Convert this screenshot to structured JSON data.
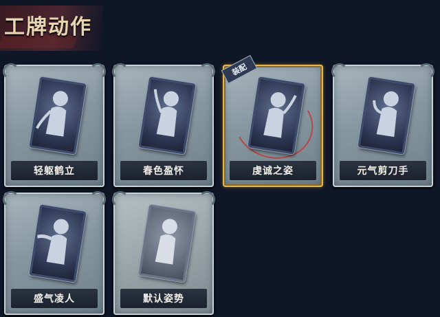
{
  "header": {
    "title": "工牌动作"
  },
  "cards": [
    {
      "label": "轻躯鹤立",
      "equipped": false,
      "disabled": false
    },
    {
      "label": "春色盈怀",
      "equipped": false,
      "disabled": false
    },
    {
      "label": "虔诚之姿",
      "equipped": true,
      "disabled": false,
      "badge": "装配"
    },
    {
      "label": "元气剪刀手",
      "equipped": false,
      "disabled": false
    },
    {
      "label": "盛气凌人",
      "equipped": false,
      "disabled": false
    },
    {
      "label": "默认姿势",
      "equipped": false,
      "disabled": true
    }
  ],
  "colors": {
    "background": "#0f1626",
    "title": "#e8d6b0",
    "equipped_frame": "#e2b655",
    "label_bg": "#1b222d"
  }
}
